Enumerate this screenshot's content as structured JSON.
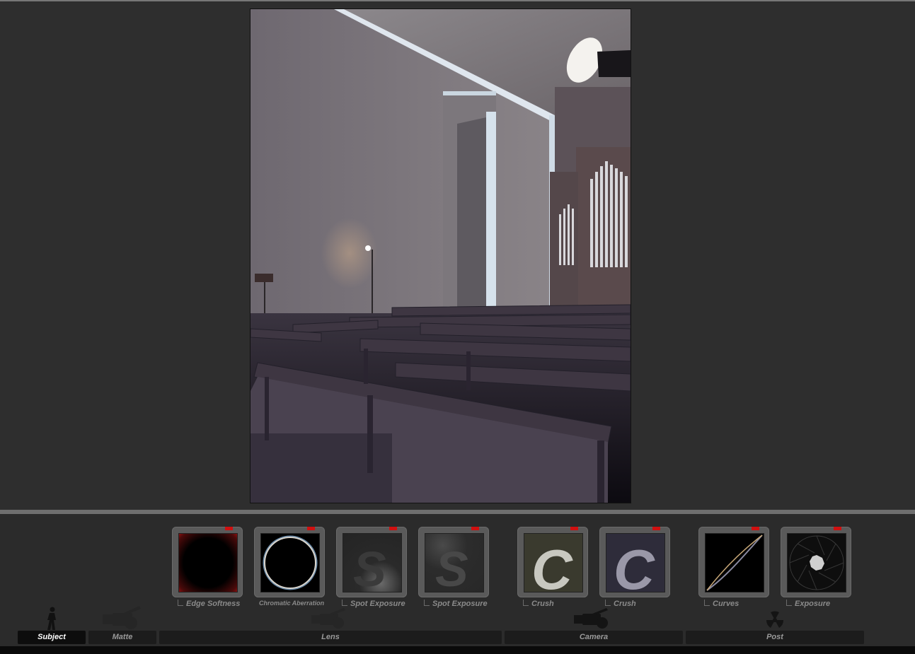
{
  "effects": [
    {
      "label": "Edge Softness"
    },
    {
      "label": "Chromatic Aberration"
    },
    {
      "label": "Spot Exposure"
    },
    {
      "label": "Spot Exposure"
    },
    {
      "label": "Crush"
    },
    {
      "label": "Crush"
    },
    {
      "label": "Curves"
    },
    {
      "label": "Exposure"
    }
  ],
  "tabs": [
    {
      "label": "Subject",
      "icon": "person-icon",
      "active": true
    },
    {
      "label": "Matte",
      "icon": "matte-camera-icon",
      "active": false
    },
    {
      "label": "Lens",
      "icon": "lens-camera-icon",
      "active": false
    },
    {
      "label": "Camera",
      "icon": "camera-icon",
      "active": false
    },
    {
      "label": "Post",
      "icon": "radiation-icon",
      "active": false
    }
  ],
  "thumb_glyphs": {
    "spot": "S",
    "crush": "C"
  },
  "colors": {
    "flag": "#d01010",
    "active_tab": "#0d0d0d",
    "tab": "#1c1c1c"
  }
}
